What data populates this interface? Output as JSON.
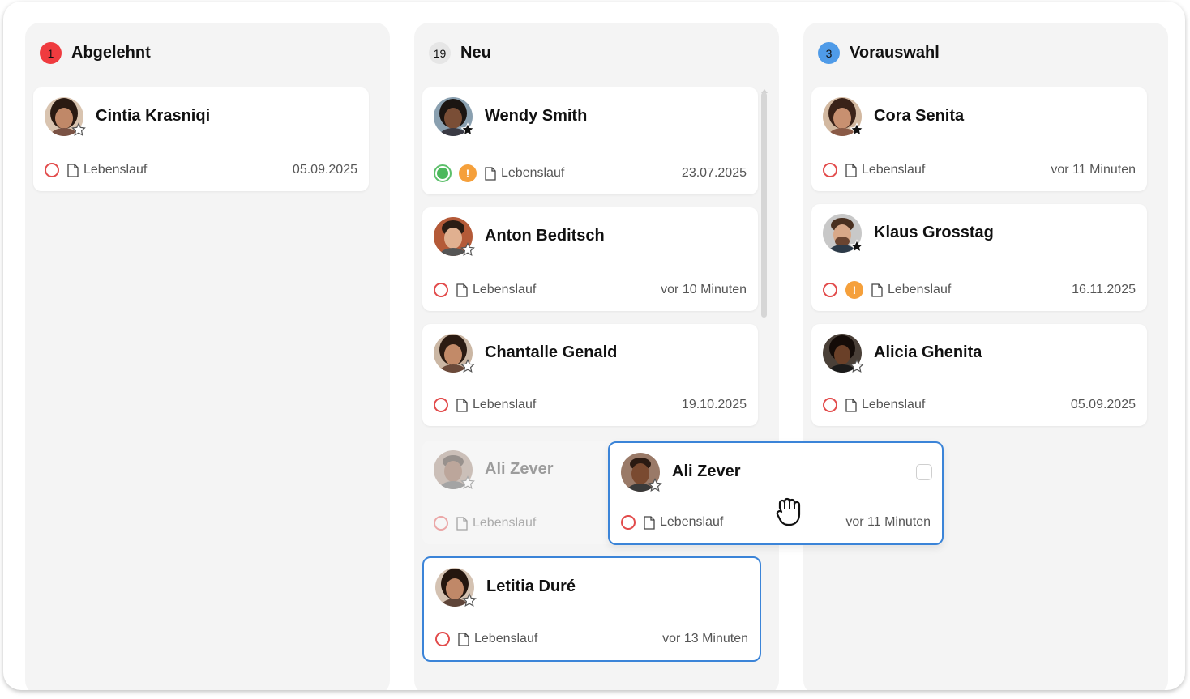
{
  "columns": [
    {
      "title": "Abgelehnt",
      "count": "1",
      "badge_color": "#ef3b3f",
      "cards": [
        {
          "name": "Cintia Krasniqi",
          "doc": "Lebenslauf",
          "date": "05.09.2025",
          "starred": false
        }
      ]
    },
    {
      "title": "Neu",
      "count": "19",
      "badge_color": "#e6e6e6",
      "cards": [
        {
          "name": "Wendy Smith",
          "doc": "Lebenslauf",
          "date": "23.07.2025",
          "starred": true,
          "status": "green",
          "warning": "!"
        },
        {
          "name": "Anton Beditsch",
          "doc": "Lebenslauf",
          "date": "vor 10 Minuten",
          "starred": false
        },
        {
          "name": "Chantalle Genald",
          "doc": "Lebenslauf",
          "date": "19.10.2025",
          "starred": false
        },
        {
          "name": "Ali Zever",
          "doc": "Lebenslauf",
          "date": "",
          "starred": false,
          "placeholder": true
        },
        {
          "name": "Letitia Duré",
          "doc": "Lebenslauf",
          "date": "vor 13 Minuten",
          "starred": false,
          "selected": true
        }
      ]
    },
    {
      "title": "Vorauswahl",
      "count": "3",
      "badge_color": "#4f9be8",
      "cards": [
        {
          "name": "Cora Senita",
          "doc": "Lebenslauf",
          "date": "vor 11 Minuten",
          "starred": true
        },
        {
          "name": "Klaus Grosstag",
          "doc": "Lebenslauf",
          "date": "16.11.2025",
          "starred": true,
          "warning": "!"
        },
        {
          "name": "Alicia Ghenita",
          "doc": "Lebenslauf",
          "date": "05.09.2025",
          "starred": false
        }
      ]
    }
  ],
  "dragging_card": {
    "name": "Ali Zever",
    "doc": "Lebenslauf",
    "date": "vor 11 Minuten",
    "starred": false
  },
  "cursor": "grab-hand-icon",
  "colors": {
    "accent": "#3b84d8",
    "reject_ring": "#e24b4b",
    "warning": "#f5a03b",
    "success": "#4cb85c"
  }
}
